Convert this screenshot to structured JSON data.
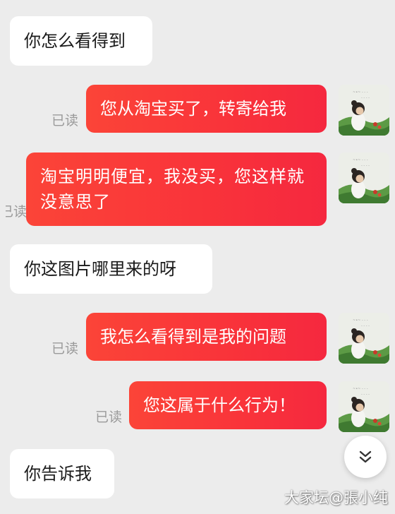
{
  "messages": [
    {
      "text": "你怎么看得到"
    },
    {
      "text": "您从淘宝买了，转寄给我",
      "read": "已读"
    },
    {
      "text": "淘宝明明便宜，我没买，您这样就没意思了",
      "read": "已读"
    },
    {
      "text": "你这图片哪里来的呀"
    },
    {
      "text": "我怎么看得到是我的问题",
      "read": "已读"
    },
    {
      "text": "您这属于什么行为！",
      "read": "已读"
    },
    {
      "text": "你告诉我"
    }
  ],
  "watermark": "大家坛@張小纯",
  "icons": {
    "scroll_down": "double-chevron-down-icon",
    "avatar": "child-photo-avatar"
  },
  "colors": {
    "background": "#ececec",
    "outgoing_bubble": "#f9333a",
    "incoming_bubble": "#ffffff",
    "read_receipt": "#9a9a9a"
  }
}
